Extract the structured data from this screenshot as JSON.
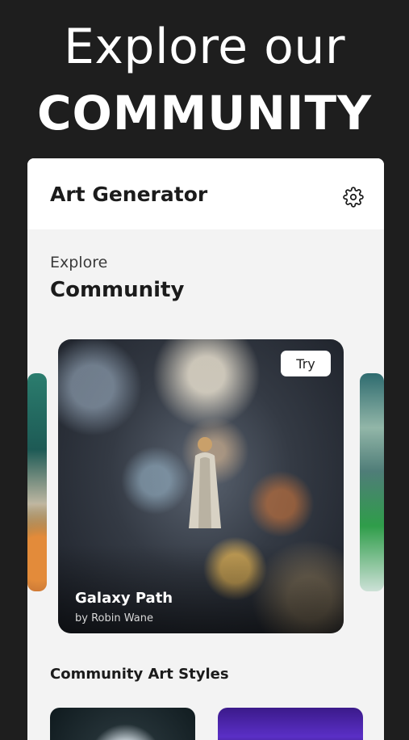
{
  "promo": {
    "line1": "Explore our",
    "line2": "COMMUNITY"
  },
  "appbar": {
    "title": "Art Generator",
    "settings_icon": "gear-icon"
  },
  "section": {
    "eyebrow": "Explore",
    "heading": "Community"
  },
  "featured": {
    "title": "Galaxy Path",
    "author": "by Robin Wane",
    "try_label": "Try"
  },
  "styles": {
    "heading": "Community Art Styles"
  },
  "colors": {
    "background": "#1e1e1e",
    "surface": "#f3f3f3",
    "card_text": "#ffffff",
    "title_text": "#1b1b1b"
  }
}
